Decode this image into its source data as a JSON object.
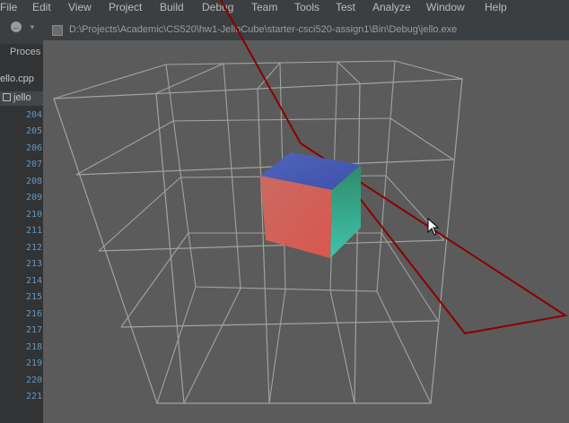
{
  "menu": {
    "items": [
      "File",
      "Edit",
      "View",
      "Project",
      "Build",
      "Debug",
      "Team",
      "Tools",
      "Test",
      "Analyze",
      "Window",
      "Help"
    ]
  },
  "ide": {
    "process_label": "Proces",
    "file_tab": "ello.cpp",
    "outline_item": "jello",
    "gutter_lines": [
      "204",
      "205",
      "206",
      "207",
      "208",
      "209",
      "210",
      "211",
      "212",
      "213",
      "214",
      "215",
      "216",
      "217",
      "218",
      "219",
      "220",
      "221"
    ]
  },
  "window": {
    "title": "D:\\Projects\\Academic\\CS520\\hw1-JelloCube\\starter-csci520-assign1\\Bin\\Debug\\jello.exe"
  },
  "colors": {
    "gl_background": "#5b5b5b",
    "grid_lines": "#9e9e9e",
    "plane_outline": "#8b0000",
    "cube_front": "#d0605d",
    "cube_top": "#4a57b2",
    "cube_side": "#2f9a74"
  }
}
